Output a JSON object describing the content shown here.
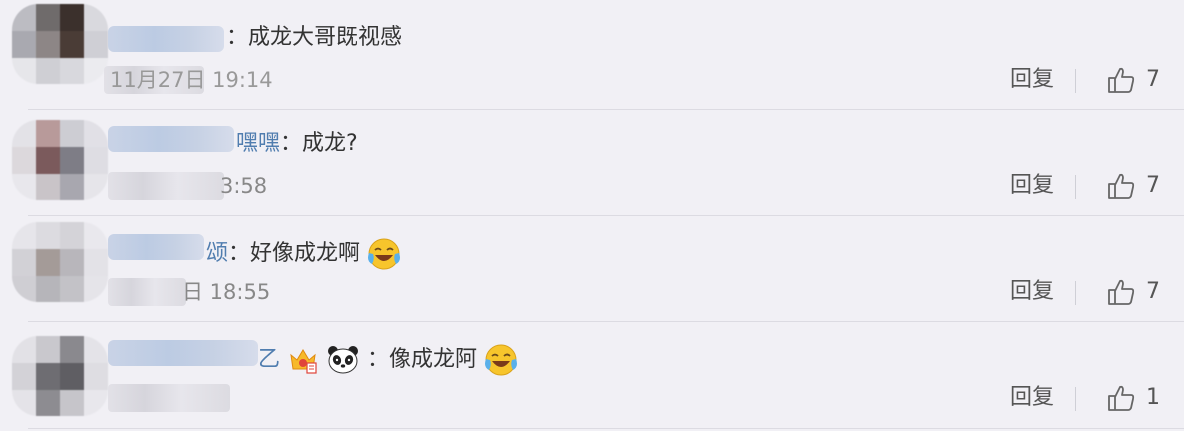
{
  "comments": [
    {
      "name_suffix": "",
      "text": "：成龙大哥既视感",
      "time": "11月27日 19:14",
      "reply_label": "回复",
      "like_count": "7"
    },
    {
      "name_suffix": "嘿嘿",
      "text": "：成龙?",
      "time": "3:58",
      "reply_label": "回复",
      "like_count": "7"
    },
    {
      "name_suffix": "颂",
      "text": "：好像成龙啊",
      "time": "日 18:55",
      "reply_label": "回复",
      "like_count": "7",
      "emoji": "laugh-cry-emoji"
    },
    {
      "name_suffix": "乙",
      "badges": [
        "crown-badge-icon",
        "panda-emoji"
      ],
      "text": "：像成龙阿",
      "time": "",
      "reply_label": "回复",
      "like_count": "1",
      "emoji": "laugh-cry-emoji"
    }
  ],
  "colors": {
    "background": "#f1f0f5",
    "link": "#507daf",
    "text": "#333333",
    "muted": "#888888"
  }
}
